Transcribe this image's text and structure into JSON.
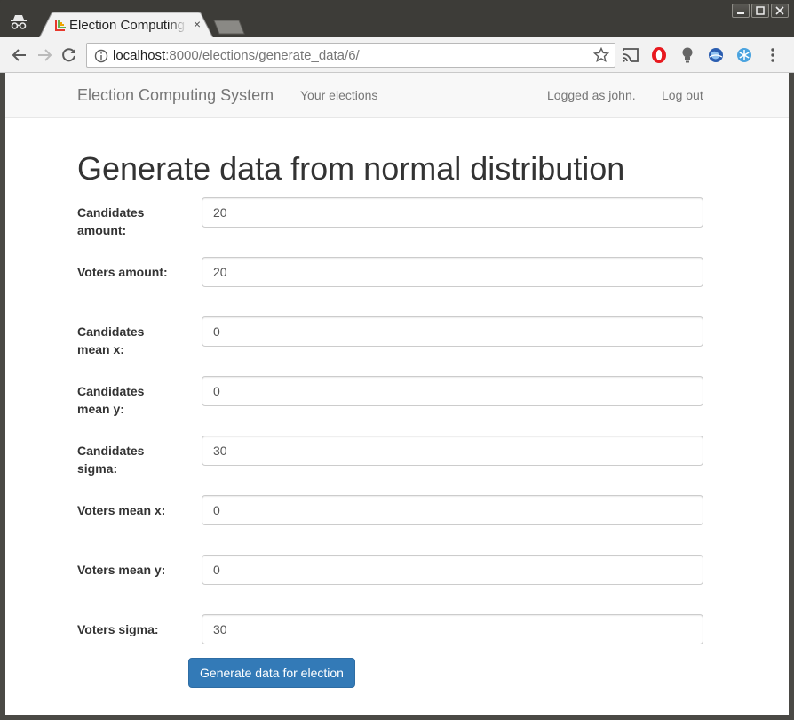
{
  "browser": {
    "tab_title": "Election Computing System",
    "tab_close": "×",
    "url_host": "localhost",
    "url_path": ":8000/elections/generate_data/6/",
    "window_controls": [
      "minimize-icon",
      "maximize-icon",
      "close-icon"
    ],
    "extensions": [
      "cast-icon",
      "opera-icon",
      "bulb-icon",
      "globe-icon",
      "snowflake-icon",
      "menu-icon"
    ]
  },
  "navbar": {
    "brand": "Election Computing System",
    "your_elections": "Your elections",
    "logged_as": "Logged as john.",
    "logout": "Log out"
  },
  "page": {
    "title": "Generate data from normal distribution",
    "fields": [
      {
        "label": "Candidates amount:",
        "value": "20"
      },
      {
        "label": "Voters amount:",
        "value": "20"
      },
      {
        "label": "Candidates mean x:",
        "value": "0"
      },
      {
        "label": "Candidates mean y:",
        "value": "0"
      },
      {
        "label": "Candidates sigma:",
        "value": "30"
      },
      {
        "label": "Voters mean x:",
        "value": "0"
      },
      {
        "label": "Voters mean y:",
        "value": "0"
      },
      {
        "label": "Voters sigma:",
        "value": "30"
      }
    ],
    "submit_label": "Generate data for election"
  },
  "colors": {
    "primary": "#337ab7",
    "navbar_bg": "#f8f8f8",
    "frame": "#3d3c38"
  }
}
